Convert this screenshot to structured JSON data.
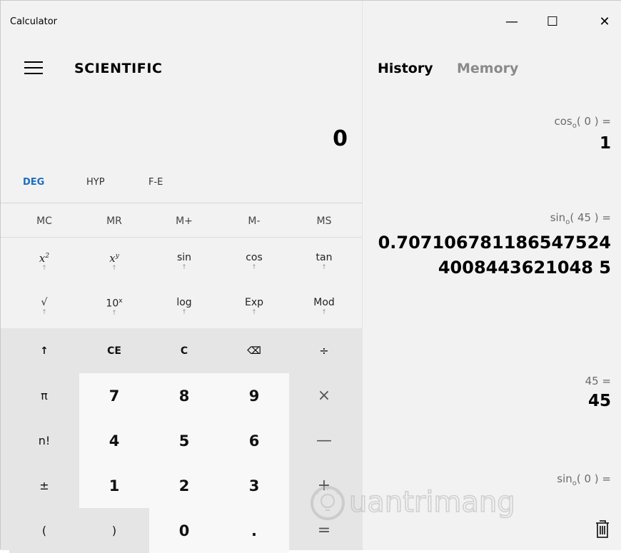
{
  "app": {
    "title": "Calculator",
    "mode_title": "SCIENTIFIC",
    "display": "0"
  },
  "modes": {
    "deg": "DEG",
    "hyp": "HYP",
    "fe": "F-E"
  },
  "memory_buttons": [
    "MC",
    "MR",
    "M+",
    "M-",
    "MS"
  ],
  "function_rows": [
    [
      {
        "base": "x",
        "sup": "2",
        "italic": true
      },
      {
        "base": "x",
        "sup": "y",
        "italic": true
      },
      {
        "base": "sin",
        "sup": "",
        "italic": false
      },
      {
        "base": "cos",
        "sup": "",
        "italic": false
      },
      {
        "base": "tan",
        "sup": "",
        "italic": false
      }
    ],
    [
      {
        "base": "√",
        "sup": "",
        "italic": false
      },
      {
        "base": "10",
        "sup": "x",
        "italic": false
      },
      {
        "base": "log",
        "sup": "",
        "italic": false
      },
      {
        "base": "Exp",
        "sup": "",
        "italic": false
      },
      {
        "base": "Mod",
        "sup": "",
        "italic": false
      }
    ]
  ],
  "function_arrow": "↑",
  "keypad_rows": [
    [
      "↑",
      "CE",
      "C",
      "⌫",
      "÷"
    ],
    [
      "π",
      "7",
      "8",
      "9",
      "×"
    ],
    [
      "n!",
      "4",
      "5",
      "6",
      "—"
    ],
    [
      "±",
      "1",
      "2",
      "3",
      "+"
    ],
    [
      "(",
      ")",
      "0",
      ".",
      "="
    ]
  ],
  "window_controls": {
    "minimize": "—",
    "maximize": "☐",
    "close": "✕"
  },
  "tabs": {
    "history": "History",
    "memory": "Memory"
  },
  "history": [
    {
      "fn": "cos",
      "sub": "o",
      "arg": "( 0 ) =",
      "result": "1"
    },
    {
      "fn": "sin",
      "sub": "o",
      "arg": "( 45 ) =",
      "result": "0.7071067811865475244008443621048 5"
    },
    {
      "fn": "45 =",
      "sub": "",
      "arg": "",
      "result": "45"
    },
    {
      "fn": "sin",
      "sub": "o",
      "arg": "( 0 ) =",
      "result": ""
    }
  ],
  "watermark_text": "uantrimang"
}
